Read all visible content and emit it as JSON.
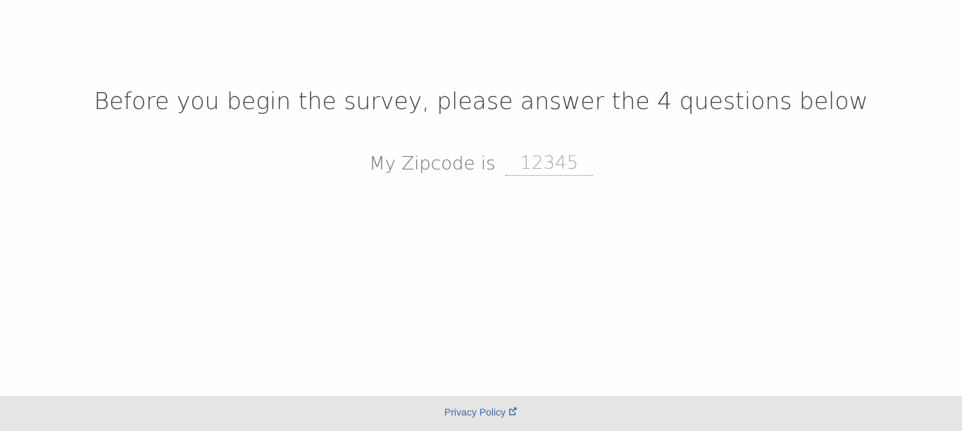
{
  "main": {
    "headline": "Before you begin the survey, please answer the 4 questions below",
    "zipcode": {
      "label": "My Zipcode is",
      "value": "",
      "placeholder": "12345"
    }
  },
  "footer": {
    "privacy_link": "Privacy Policy",
    "privacy_icon": "external-link-icon"
  },
  "colors": {
    "background": "#fefefe",
    "footer_background": "#e5e5e5",
    "link": "#3d6aa8",
    "headline_text": "#3b3f47",
    "label_text": "#6b7080"
  }
}
